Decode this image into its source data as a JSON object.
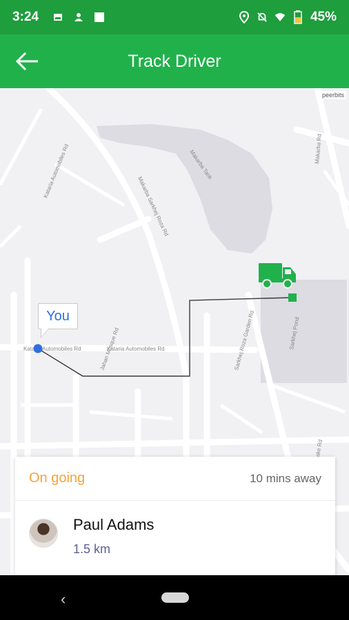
{
  "status_bar": {
    "time": "3:24",
    "battery": "45%",
    "icons": [
      "image-icon",
      "person-icon",
      "square-icon",
      "location-icon",
      "mute-icon",
      "wifi-icon",
      "battery-icon"
    ]
  },
  "app_bar": {
    "title": "Track Driver",
    "back_icon": "arrow-left-icon"
  },
  "map": {
    "attribution": "peerbits",
    "you_label": "You",
    "road_labels": [
      "Kataria Automobiles Rd",
      "Kataria Automobiles Rd",
      "Kataria Automobiles Rd",
      "Makarba Sarkhej Roza Rd",
      "Jahan Mosque Rd",
      "Sarkhej Roza Garden Rd",
      "Sarkhej Pond",
      "Makarba Tank",
      "Makarba Rd",
      "Lake Rd"
    ],
    "truck_icon": "truck-icon",
    "route_color": "#3a3a3a",
    "truck_color": "#21b14b",
    "you_marker_color": "#2f6fe0"
  },
  "card": {
    "status": "On going",
    "eta": "10 mins away",
    "driver_name": "Paul Adams",
    "distance": "1.5 km"
  },
  "colors": {
    "status_bar": "#1e9e3c",
    "app_bar": "#21b14b",
    "status_label": "#f7a23b",
    "distance_text": "#5a5f96"
  }
}
